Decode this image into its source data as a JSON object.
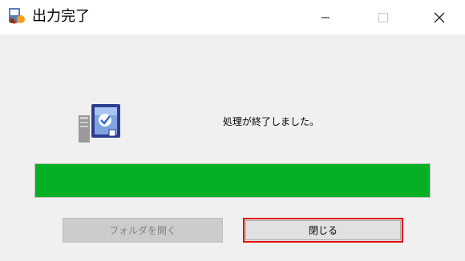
{
  "window": {
    "title": "出力完了",
    "controls": {
      "minimize": "minimize-icon",
      "maximize": "maximize-icon",
      "close": "close-icon"
    }
  },
  "content": {
    "icon": "computer-check-icon",
    "message": "処理が終了しました。",
    "progress": {
      "value": 1.0,
      "color": "#06b025"
    }
  },
  "buttons": {
    "open_folder_label": "フォルダを開く",
    "open_folder_enabled": false,
    "close_label": "閉じる",
    "close_highlight_color": "#e00000"
  }
}
